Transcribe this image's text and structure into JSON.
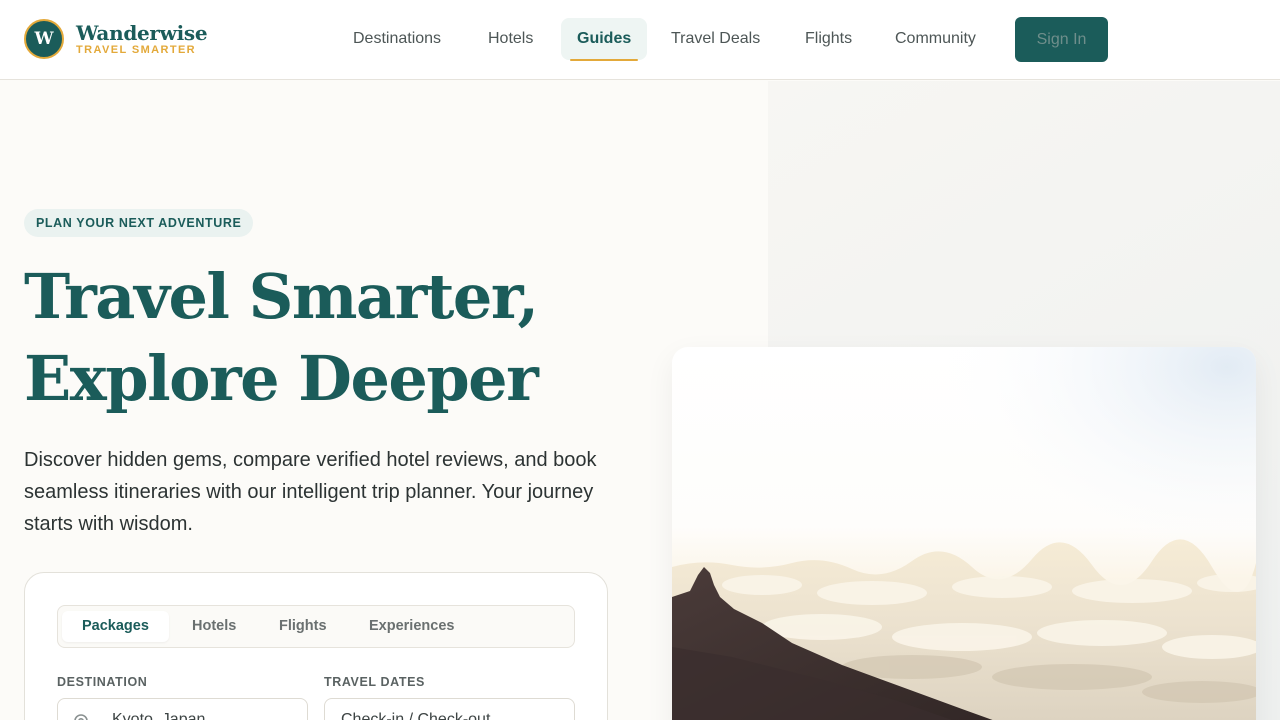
{
  "brand": {
    "initial": "W",
    "name": "Wanderwise",
    "tagline": "TRAVEL SMARTER"
  },
  "nav": {
    "items": [
      {
        "label": "Destinations"
      },
      {
        "label": "Hotels"
      },
      {
        "label": "Guides",
        "active": true
      },
      {
        "label": "Travel Deals"
      },
      {
        "label": "Flights"
      },
      {
        "label": "Community"
      }
    ],
    "signin_label": "Sign In"
  },
  "hero": {
    "eyebrow": "PLAN YOUR NEXT ADVENTURE",
    "headline_line1": "Travel Smarter,",
    "headline_line2": "Explore Deeper",
    "subtitle": "Discover hidden gems, compare verified hotel reviews, and book seamless itineraries with our intelligent trip planner. Your journey starts with wisdom."
  },
  "search": {
    "tabs": [
      {
        "label": "Packages",
        "active": true
      },
      {
        "label": "Hotels"
      },
      {
        "label": "Flights"
      },
      {
        "label": "Experiences"
      }
    ],
    "destination_label": "DESTINATION",
    "destination_value": "Kyoto, Japan",
    "dates_label": "TRAVEL DATES",
    "dates_value": "Check-in / Check-out"
  },
  "colors": {
    "brand": "#1b5c5a",
    "accent": "#e3a93a",
    "background": "#fcfbf8"
  },
  "icons": {
    "destination": "map-pin-icon"
  }
}
